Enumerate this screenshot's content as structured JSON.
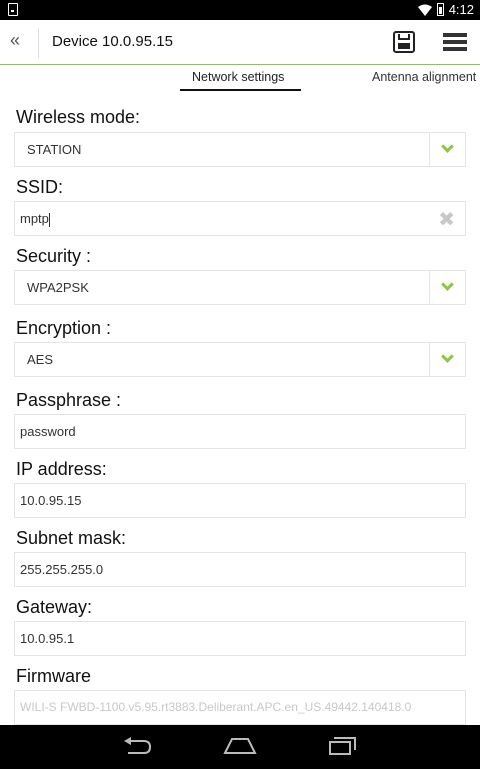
{
  "status_bar": {
    "time": "4:12"
  },
  "app_bar": {
    "back_glyph": "«",
    "title": "Device 10.0.95.15"
  },
  "tabs": [
    {
      "label": "Network settings",
      "active": true
    },
    {
      "label": "Antenna alignment",
      "active": false
    }
  ],
  "form": {
    "wireless_mode": {
      "label": "Wireless mode:",
      "value": "STATION"
    },
    "ssid": {
      "label": "SSID:",
      "value": "mptp"
    },
    "security": {
      "label": "Security :",
      "value": "WPA2PSK"
    },
    "encryption": {
      "label": "Encryption :",
      "value": "AES"
    },
    "passphrase": {
      "label": "Passphrase :",
      "value": "password"
    },
    "ip_address": {
      "label": "IP address:",
      "value": "10.0.95.15"
    },
    "subnet_mask": {
      "label": "Subnet mask:",
      "value": "255.255.255.0"
    },
    "gateway": {
      "label": "Gateway:",
      "value": "10.0.95.1"
    },
    "firmware": {
      "label": "Firmware",
      "value": "WILI-S FWBD-1100.v5.95.rt3883.Deliberant.APC.en_US.49442.140418.0"
    }
  },
  "colors": {
    "accent": "#8dc63f",
    "status_bar": "#000000",
    "nav_bar": "#000000"
  },
  "icons": {
    "back": "double-chevron-left-icon",
    "save": "floppy-disk-icon",
    "menu": "hamburger-menu-icon",
    "dropdown": "chevron-down-icon",
    "clear": "clear-x-icon"
  }
}
